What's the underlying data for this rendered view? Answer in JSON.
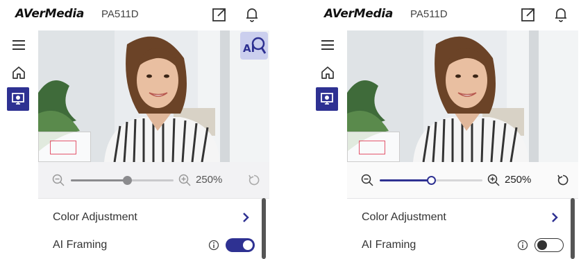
{
  "brand": {
    "name": "AVerMedia",
    "model": "PA511D"
  },
  "header_icons": [
    "external-link-icon",
    "bell-icon"
  ],
  "sidebar": [
    "menu-icon",
    "home-icon",
    "camera-view-icon"
  ],
  "ai_button": {
    "label": "AI",
    "icon": "ai-search-icon"
  },
  "panels": [
    {
      "state": "ai-framing-on",
      "zoom": {
        "value": "250%",
        "slider_fraction": 0.55,
        "enabled": false
      },
      "settings": [
        {
          "label": "Color Adjustment",
          "type": "link"
        },
        {
          "label": "AI Framing",
          "type": "toggle",
          "on": true
        }
      ],
      "show_ai_button": true
    },
    {
      "state": "ai-framing-off",
      "zoom": {
        "value": "250%",
        "slider_fraction": 0.5,
        "enabled": true
      },
      "settings": [
        {
          "label": "Color Adjustment",
          "type": "link"
        },
        {
          "label": "AI Framing",
          "type": "toggle",
          "on": false
        }
      ],
      "show_ai_button": false
    }
  ],
  "colors": {
    "accent": "#2e3192",
    "minimap_frame": "#e3546b",
    "zoombar_bg": "#f2f2f4"
  }
}
